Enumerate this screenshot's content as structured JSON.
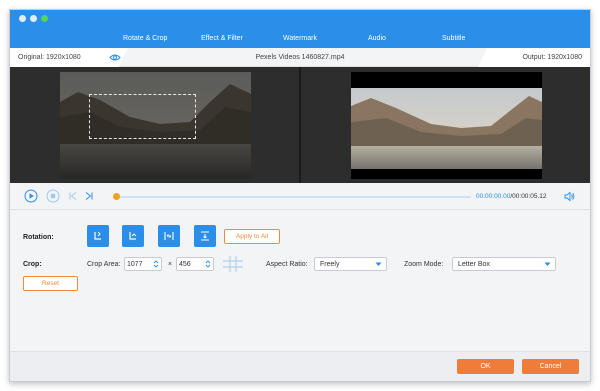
{
  "tabs": [
    "Rotate & Crop",
    "Effect & Filter",
    "Watermark",
    "Audio",
    "Subtitle"
  ],
  "info": {
    "original": "Original: 1920x1080",
    "file_name": "Pexels Videos 1460827.mp4",
    "output": "Output: 1920x1080"
  },
  "player": {
    "time_current": "00:00:00.00",
    "time_separator": "/",
    "time_total": "00:00:05.12",
    "progress": 0.0
  },
  "rotation": {
    "label": "Rotation:",
    "apply_all": "Apply to All"
  },
  "crop": {
    "label": "Crop:",
    "area_label": "Crop Area:",
    "width": "1077",
    "times": "×",
    "height": "456",
    "aspect_label": "Aspect Ratio:",
    "aspect_value": "Freely",
    "zoom_label": "Zoom Mode:",
    "zoom_value": "Letter Box",
    "reset": "Reset"
  },
  "actions": {
    "ok": "OK",
    "cancel": "Cancel"
  },
  "colors": {
    "accent_blue": "#2b8ee8",
    "accent_orange": "#f07c3a"
  }
}
